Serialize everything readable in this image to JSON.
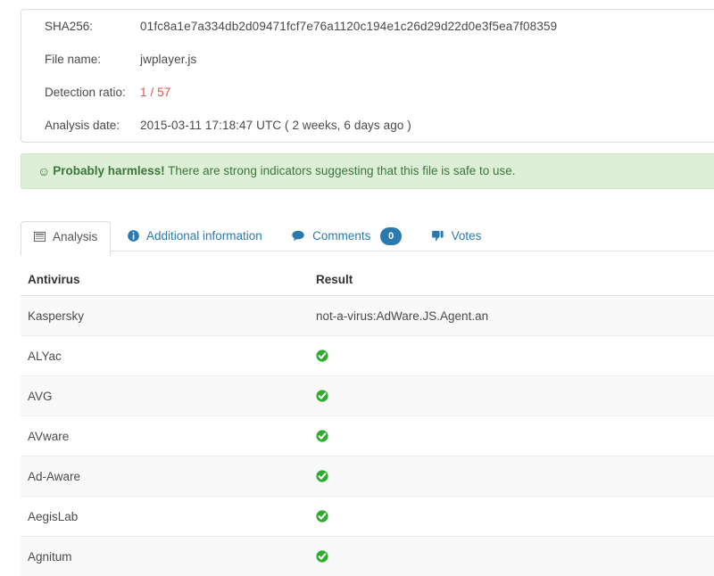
{
  "file_info": {
    "rows": [
      {
        "label": "SHA256:",
        "value": "01fc8a1e7a334db2d09471fcf7e76a1120c194e1c26d29d22d0e3f5ea7f08359",
        "style": "normal"
      },
      {
        "label": "File name:",
        "value": "jwplayer.js",
        "style": "normal"
      },
      {
        "label": "Detection ratio:",
        "value": "1 / 57",
        "style": "danger"
      },
      {
        "label": "Analysis date:",
        "value": "2015-03-11 17:18:47 UTC ( 2 weeks, 6 days ago )",
        "style": "normal"
      }
    ]
  },
  "alert": {
    "icon": "smiley-face-icon",
    "glyph": "☺",
    "strong_text": "Probably harmless!",
    "message": " There are strong indicators suggesting that this file is safe to use.",
    "background_color": "#ddefd6",
    "text_color": "#3c763d"
  },
  "tabs": [
    {
      "id": "analysis",
      "label": "Analysis",
      "icon": "list-table-icon",
      "active": true,
      "badge": null
    },
    {
      "id": "additional-information",
      "label": "Additional information",
      "icon": "info-circle-icon",
      "active": false,
      "badge": null
    },
    {
      "id": "comments",
      "label": "Comments",
      "icon": "speech-bubble-icon",
      "active": false,
      "badge": "0"
    },
    {
      "id": "votes",
      "label": "Votes",
      "icon": "thumbs-down-icon",
      "active": false,
      "badge": null
    }
  ],
  "results_table": {
    "columns": [
      "Antivirus",
      "Result"
    ],
    "rows": [
      {
        "antivirus": "Kaspersky",
        "result": "not-a-virus:AdWare.JS.Agent.an",
        "detected": true
      },
      {
        "antivirus": "ALYac",
        "result": "",
        "detected": false
      },
      {
        "antivirus": "AVG",
        "result": "",
        "detected": false
      },
      {
        "antivirus": "AVware",
        "result": "",
        "detected": false
      },
      {
        "antivirus": "Ad-Aware",
        "result": "",
        "detected": false
      },
      {
        "antivirus": "AegisLab",
        "result": "",
        "detected": false
      },
      {
        "antivirus": "Agnitum",
        "result": "",
        "detected": false
      }
    ],
    "clean_icon": "green-check-circle-icon"
  },
  "colors": {
    "link": "#2a7ab0",
    "danger": "#d9534f",
    "malicious_result": "#cc3b3b",
    "clean_green": "#2eac2e",
    "alert_green_bg": "#ddefd6",
    "border": "#dddddd"
  }
}
